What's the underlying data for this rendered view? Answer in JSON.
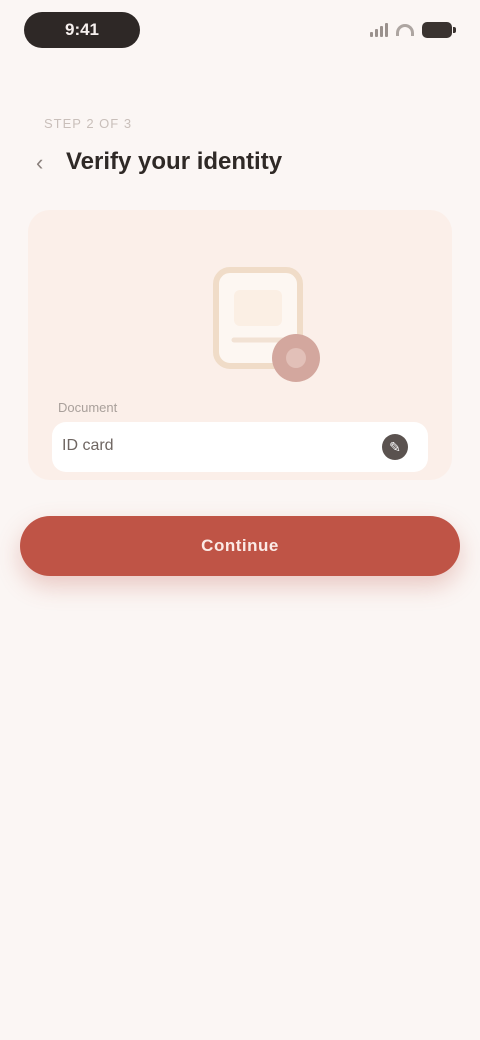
{
  "status_bar": {
    "time": "9:41"
  },
  "header": {
    "eyebrow": "Step 2 of 3",
    "title": "Verify your identity"
  },
  "card": {
    "field_label": "Document",
    "field_value": "ID card"
  },
  "actions": {
    "primary_label": "Continue"
  },
  "colors": {
    "background": "#fbf6f4",
    "accent": "#bf5446",
    "card": "#fbefe9"
  },
  "icons": [
    "signal-icon",
    "wifi-icon",
    "battery-icon",
    "back-arrow-icon",
    "document-illustration",
    "edit-icon"
  ]
}
